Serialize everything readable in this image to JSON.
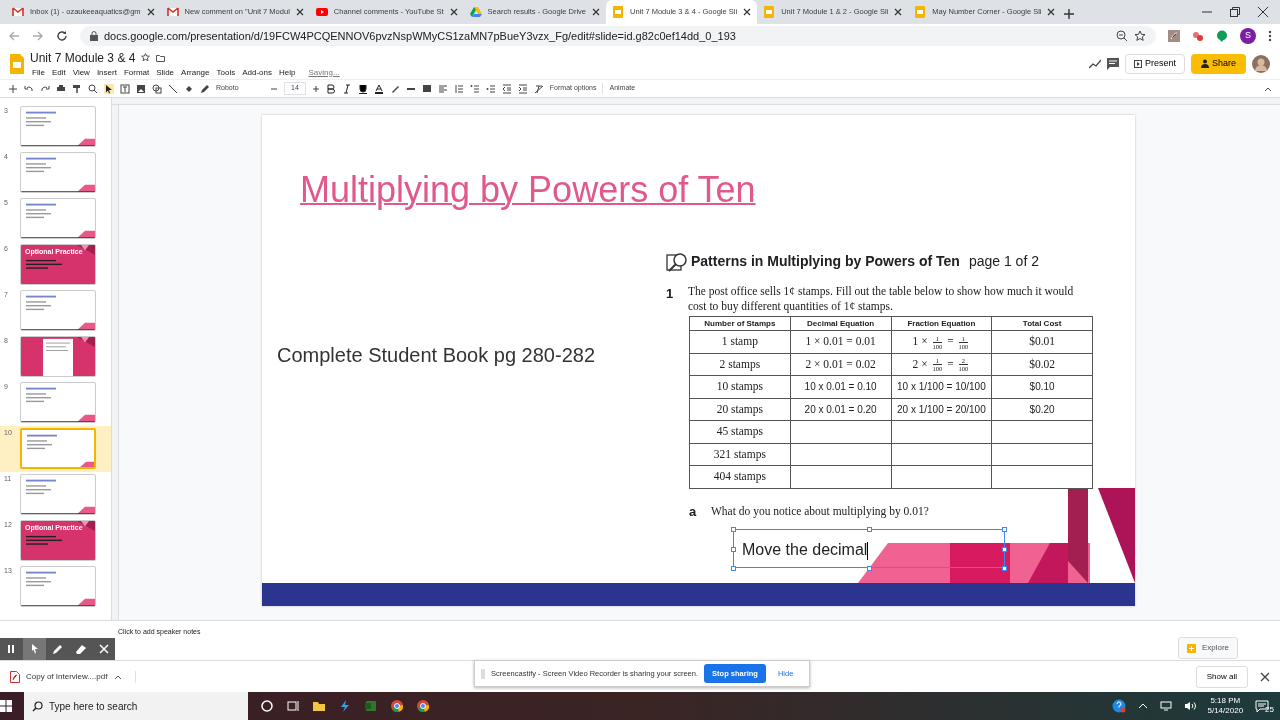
{
  "browser": {
    "tabs": [
      {
        "title": "Inbox (1) - ozaukeeaquatics@gm",
        "selected": false
      },
      {
        "title": "New comment on \"Unit 7 Modul",
        "selected": false
      },
      {
        "title": "Channel comments - YouTube St",
        "selected": false
      },
      {
        "title": "Search results - Google Drive",
        "selected": false
      },
      {
        "title": "Unit 7 Module 3 & 4 - Google Sli",
        "selected": true
      },
      {
        "title": "Unit 7 Module 1 & 2 - Google Sli",
        "selected": false
      },
      {
        "title": "May Number Corner - Google Sli",
        "selected": false
      }
    ],
    "url": "docs.google.com/presentation/d/19FCW4PCQENNOV6pvzNspWMyCS1zaMN7pBueY3vzx_Fg/edit#slide=id.g82c0ef14dd_0_193",
    "profile_initial": "S"
  },
  "doc": {
    "title": "Unit 7 Module 3 & 4",
    "menus": [
      "File",
      "Edit",
      "View",
      "Insert",
      "Format",
      "Slide",
      "Arrange",
      "Tools",
      "Add-ons",
      "Help"
    ],
    "save_status": "Saving...",
    "present": "Present",
    "share": "Share"
  },
  "toolbar": {
    "font": "Roboto",
    "font_size": "14",
    "format_options": "Format options",
    "animate": "Animate"
  },
  "filmstrip": [
    {
      "number": "3",
      "kind": "white",
      "selected": false
    },
    {
      "number": "4",
      "kind": "white",
      "selected": false
    },
    {
      "number": "5",
      "kind": "white",
      "selected": false
    },
    {
      "number": "6",
      "kind": "pink",
      "title": "Optional Practice",
      "selected": false
    },
    {
      "number": "7",
      "kind": "white",
      "selected": false
    },
    {
      "number": "8",
      "kind": "pink",
      "selected": false
    },
    {
      "number": "9",
      "kind": "white",
      "selected": false
    },
    {
      "number": "10",
      "kind": "white",
      "selected": true
    },
    {
      "number": "11",
      "kind": "white",
      "selected": false
    },
    {
      "number": "12",
      "kind": "pink",
      "title": "Optional Practice",
      "selected": false
    },
    {
      "number": "13",
      "kind": "white",
      "selected": false
    }
  ],
  "slide": {
    "title": "Multiplying by Powers of Ten",
    "body": "Complete Student Book pg 280-282",
    "worksheet": {
      "heading": "Patterns in Multiplying by Powers of Ten",
      "page": "page 1 of 2",
      "problem_number": "1",
      "problem": "The post office sells 1¢ stamps. Fill out the table below to show how much it would cost to buy different quantities of 1¢ stamps.",
      "columns": [
        "Number of Stamps",
        "Decimal Equation",
        "Fraction Equation",
        "Total Cost"
      ],
      "rows": [
        {
          "cells": [
            {
              "kind": "printed",
              "text": "1 stamp"
            },
            {
              "kind": "printed",
              "text": "1 × 0.01 = 0.01"
            },
            {
              "kind": "fraction",
              "tokens": [
                {
                  "text": "1 ×"
                },
                {
                  "num": "1",
                  "den": "100"
                },
                {
                  "text": "="
                },
                {
                  "num": "1",
                  "den": "100"
                }
              ]
            },
            {
              "kind": "printed",
              "text": "$0.01"
            }
          ]
        },
        {
          "cells": [
            {
              "kind": "printed",
              "text": "2 stamps"
            },
            {
              "kind": "printed",
              "text": "2 × 0.01 = 0.02"
            },
            {
              "kind": "fraction",
              "tokens": [
                {
                  "text": "2 ×"
                },
                {
                  "num": "1",
                  "den": "100"
                },
                {
                  "text": "="
                },
                {
                  "num": "2",
                  "den": "100"
                }
              ]
            },
            {
              "kind": "printed",
              "text": "$0.02"
            }
          ]
        },
        {
          "cells": [
            {
              "kind": "printed",
              "text": "10 stamps"
            },
            {
              "kind": "typed",
              "text": "10 x 0.01 = 0.10"
            },
            {
              "kind": "typed",
              "text": "10 x 1/100 = 10/100"
            },
            {
              "kind": "typed",
              "text": "$0.10"
            }
          ]
        },
        {
          "cells": [
            {
              "kind": "printed",
              "text": "20 stamps"
            },
            {
              "kind": "typed",
              "text": "20 x 0.01 = 0.20"
            },
            {
              "kind": "typed",
              "text": "20 x 1/100 = 20/100"
            },
            {
              "kind": "typed",
              "text": "$0.20"
            }
          ]
        },
        {
          "cells": [
            {
              "kind": "printed",
              "text": "45 stamps"
            },
            {
              "kind": "blank"
            },
            {
              "kind": "blank"
            },
            {
              "kind": "blank"
            }
          ]
        },
        {
          "cells": [
            {
              "kind": "printed",
              "text": "321 stamps"
            },
            {
              "kind": "blank"
            },
            {
              "kind": "blank"
            },
            {
              "kind": "blank"
            }
          ]
        },
        {
          "cells": [
            {
              "kind": "printed",
              "text": "404 stamps"
            },
            {
              "kind": "blank"
            },
            {
              "kind": "blank"
            },
            {
              "kind": "blank"
            }
          ]
        }
      ],
      "question_letter": "a",
      "question": "What do you notice about multiplying by 0.01?"
    },
    "answer_box": {
      "text": "Move the decimal",
      "selected": true
    }
  },
  "notes": {
    "placeholder": "Click to add speaker notes"
  },
  "explore": "Explore",
  "sharing_banner": {
    "message": "Screencastify - Screen Video Recorder is sharing your screen.",
    "stop": "Stop sharing",
    "hide": "Hide"
  },
  "downloads": {
    "file": "Copy of Interview....pdf",
    "show_all": "Show all"
  },
  "taskbar": {
    "search_placeholder": "Type here to search",
    "time": "5:18 PM",
    "date": "5/14/2020",
    "notifications": "25"
  }
}
